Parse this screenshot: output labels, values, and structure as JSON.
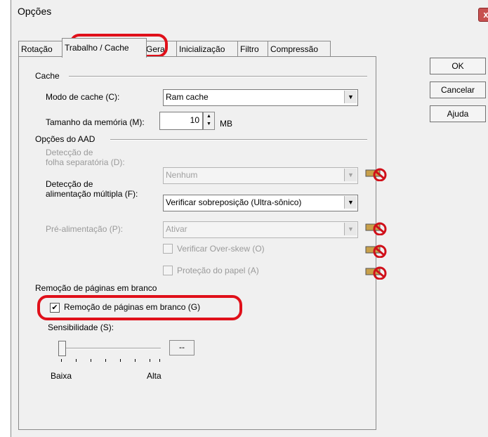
{
  "window": {
    "title": "Opções",
    "close_label": "x"
  },
  "tabs": [
    {
      "label": "Rotação"
    },
    {
      "label": "Trabalho / Cache"
    },
    {
      "label": "Geral"
    },
    {
      "label": "Inicialização"
    },
    {
      "label": "Filtro"
    },
    {
      "label": "Compressão"
    }
  ],
  "buttons": {
    "ok": "OK",
    "cancel": "Cancelar",
    "help": "Ajuda"
  },
  "cache": {
    "group_label": "Cache",
    "mode_label": "Modo de cache (C):",
    "mode_value": "Ram cache",
    "memory_label": "Tamanho da memória (M):",
    "memory_value": "10",
    "memory_unit": "MB"
  },
  "aad": {
    "group_label": "Opções do AAD",
    "separator_label_line1": "Detecção de",
    "separator_label_line2": "folha separatória (D):",
    "separator_value": "Nenhum",
    "multifeed_label_line1": "Detecção de",
    "multifeed_label_line2": "alimentação múltipla (F):",
    "multifeed_value": "Verificar sobreposição (Ultra-sônico)",
    "prefeed_label": "Pré-alimentação (P):",
    "prefeed_value": "Ativar",
    "overskew_label": "Verificar Over-skew (O)",
    "paper_protect_label": "Proteção do papel (A)"
  },
  "blank_page": {
    "group_label": "Remoção de páginas em branco",
    "checkbox_label": "Remoção de páginas em branco (G)",
    "checked": true,
    "sensitivity_label": "Sensibilidade (S):",
    "sensitivity_value": "--",
    "low_label": "Baixa",
    "high_label": "Alta"
  },
  "icons": {
    "disabled": "no-scanner-icon"
  },
  "colors": {
    "highlight": "#e0101a",
    "panel": "#f0f0f0"
  }
}
